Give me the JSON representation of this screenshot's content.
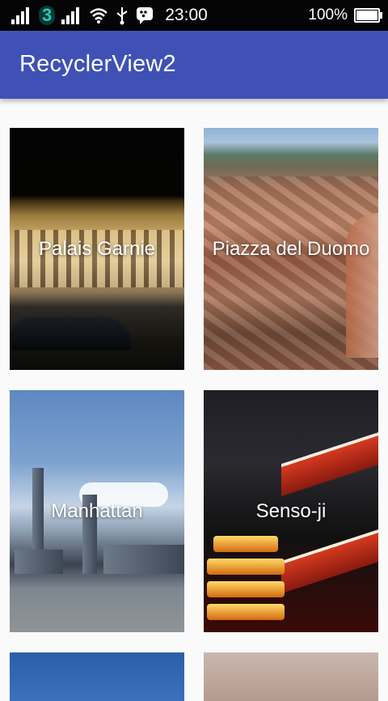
{
  "status_bar": {
    "carrier_badge": "3",
    "time": "23:00",
    "battery_percent": "100%",
    "icons": [
      "signal-icon",
      "carrier-3-icon",
      "signal-icon",
      "wifi-icon",
      "usb-icon",
      "bbm-icon",
      "battery-icon"
    ]
  },
  "app_bar": {
    "title": "RecyclerView2",
    "color": "#3f51b5"
  },
  "grid": {
    "items": [
      {
        "label": "Palais Garnie"
      },
      {
        "label": "Piazza del Duomo"
      },
      {
        "label": "Manhattan"
      },
      {
        "label": "Senso-ji"
      },
      {
        "label": ""
      },
      {
        "label": ""
      }
    ]
  }
}
